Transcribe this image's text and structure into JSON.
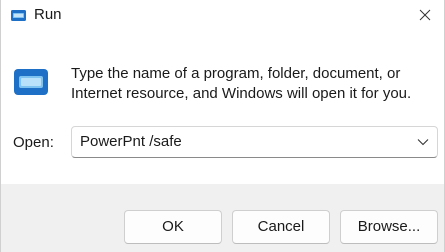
{
  "window": {
    "title": "Run",
    "title_icon": "run-app-icon",
    "close_icon": "close-icon"
  },
  "dialog": {
    "icon": "run-dialog-icon",
    "description_line1": "Type the name of a program, folder, document, or",
    "description_line2": "Internet resource, and Windows will open it for you.",
    "open_label": "Open:",
    "open_value": "PowerPnt /safe",
    "dropdown_icon": "chevron-down-icon"
  },
  "buttons": {
    "ok": "OK",
    "cancel": "Cancel",
    "browse": "Browse..."
  },
  "colors": {
    "icon_blue": "#1e6fc6",
    "icon_light": "#7fc4f0",
    "footer_bg": "#f0f0f0"
  }
}
